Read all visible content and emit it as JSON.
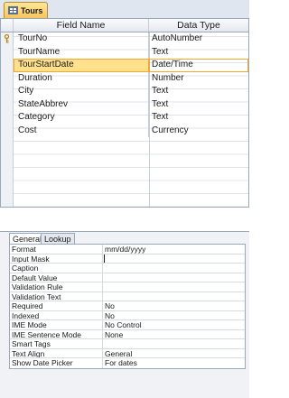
{
  "document_tab": {
    "label": "Tours",
    "icon": "table-icon"
  },
  "grid": {
    "headers": {
      "field_name": "Field Name",
      "data_type": "Data Type"
    },
    "rows": [
      {
        "field": "TourNo",
        "type": "AutoNumber",
        "primary_key": true
      },
      {
        "field": "TourName",
        "type": "Text"
      },
      {
        "field": "TourStartDate",
        "type": "Date/Time",
        "selected": true
      },
      {
        "field": "Duration",
        "type": "Number"
      },
      {
        "field": "City",
        "type": "Text"
      },
      {
        "field": "StateAbbrev",
        "type": "Text"
      },
      {
        "field": "Category",
        "type": "Text"
      },
      {
        "field": "Cost",
        "type": "Currency"
      }
    ]
  },
  "properties": {
    "tabs": [
      "General",
      "Lookup"
    ],
    "active_tab": "General",
    "rows": [
      {
        "label": "Format",
        "value": "mm/dd/yyyy"
      },
      {
        "label": "Input Mask",
        "value": ""
      },
      {
        "label": "Caption",
        "value": ""
      },
      {
        "label": "Default Value",
        "value": ""
      },
      {
        "label": "Validation Rule",
        "value": ""
      },
      {
        "label": "Validation Text",
        "value": ""
      },
      {
        "label": "Required",
        "value": "No"
      },
      {
        "label": "Indexed",
        "value": "No"
      },
      {
        "label": "IME Mode",
        "value": "No Control"
      },
      {
        "label": "IME Sentence Mode",
        "value": "None"
      },
      {
        "label": "Smart Tags",
        "value": ""
      },
      {
        "label": "Text Align",
        "value": "General"
      },
      {
        "label": "Show Date Picker",
        "value": "For dates"
      }
    ]
  },
  "colors": {
    "tab_accent": "#f7c45c",
    "selection": "#ffe08c",
    "border": "#9aa8bb"
  }
}
